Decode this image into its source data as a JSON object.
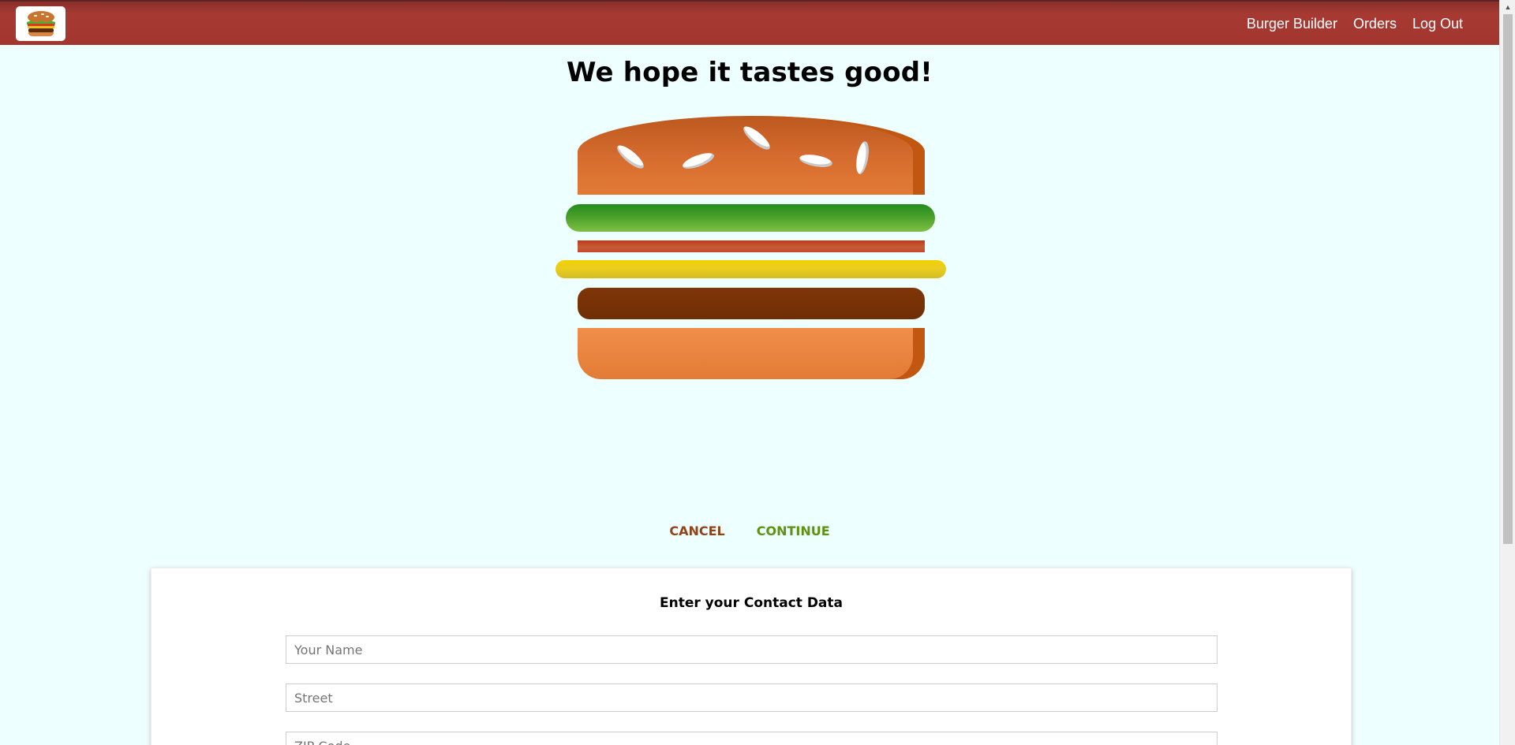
{
  "toolbar": {
    "logo_icon": "burger-logo-icon",
    "nav": [
      {
        "label": "Burger Builder"
      },
      {
        "label": "Orders"
      },
      {
        "label": "Log Out"
      }
    ],
    "background_color": "#a2362f"
  },
  "checkout": {
    "title": "We hope it tastes good!",
    "ingredients": [
      "bread-top",
      "salad",
      "bacon",
      "cheese",
      "meat",
      "bread-bottom"
    ],
    "cancel_label": "CANCEL",
    "continue_label": "CONTINUE"
  },
  "contact": {
    "heading": "Enter your Contact Data",
    "fields": [
      {
        "placeholder": "Your Name",
        "value": ""
      },
      {
        "placeholder": "Street",
        "value": ""
      },
      {
        "placeholder": "ZIP Code",
        "value": ""
      }
    ]
  },
  "colors": {
    "page_background": "#EEFFFF",
    "danger": "#944317",
    "success": "#5c9210"
  }
}
